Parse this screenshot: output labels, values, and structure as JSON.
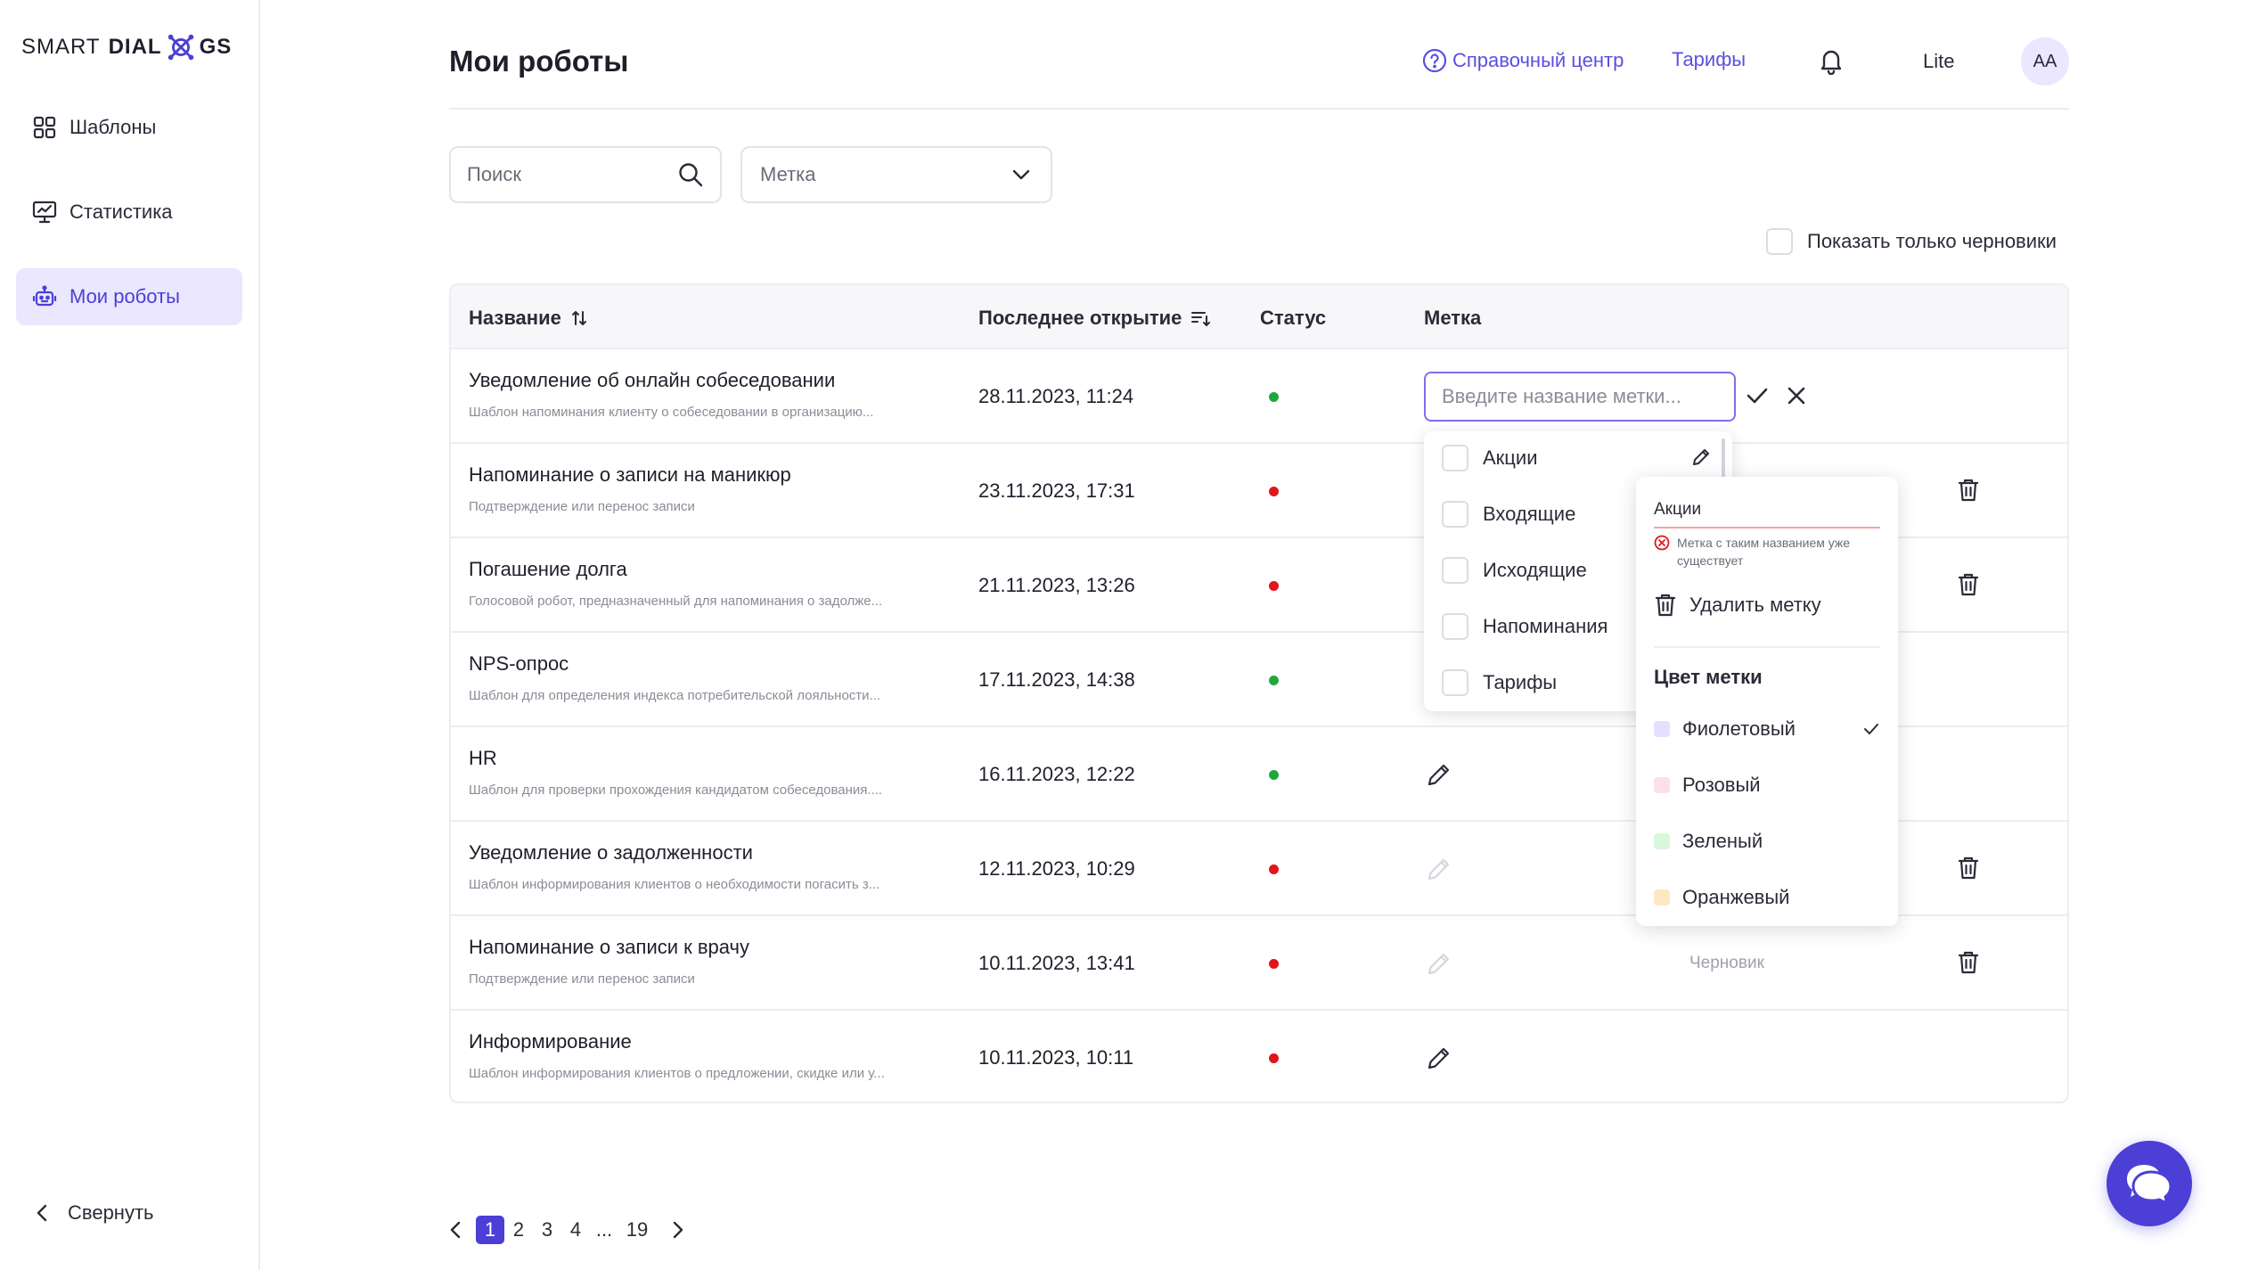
{
  "brand": {
    "logo_left": "SMART",
    "logo_right_a": "DIAL",
    "logo_right_b": "GS"
  },
  "sidebar": {
    "items": [
      {
        "label": "Шаблоны",
        "icon": "grid-icon"
      },
      {
        "label": "Статистика",
        "icon": "monitor-chart-icon"
      },
      {
        "label": "Мои роботы",
        "icon": "robot-icon",
        "active": true
      }
    ],
    "collapse_label": "Свернуть"
  },
  "header": {
    "title": "Мои роботы",
    "help_label": "Справочный центр",
    "tariffs_label": "Тарифы",
    "plan": "Lite",
    "avatar_initials": "AA"
  },
  "filters": {
    "search_placeholder": "Поиск",
    "tag_select_value": "Метка",
    "drafts_only_label": "Показать только черновики"
  },
  "table": {
    "columns": {
      "name": "Название",
      "last_opened": "Последнее открытие",
      "status": "Статус",
      "tag": "Метка"
    },
    "rows": [
      {
        "title": "Уведомление об онлайн собеседовании",
        "desc": "Шаблон напоминания клиенту о собеседовании в организацию...",
        "date": "28.11.2023, 11:24",
        "status": "active"
      },
      {
        "title": "Напоминание о записи на маникюр",
        "desc": "Подтверждение или перенос записи",
        "date": "23.11.2023, 17:31",
        "status": "inactive"
      },
      {
        "title": "Погашение долга",
        "desc": "Голосовой робот, предназначенный для напоминания о задолже...",
        "date": "21.11.2023, 13:26",
        "status": "inactive"
      },
      {
        "title": "NPS-опрос",
        "desc": "Шаблон для определения индекса потребительской лояльности...",
        "date": "17.11.2023, 14:38",
        "status": "active"
      },
      {
        "title": "HR",
        "desc": "Шаблон для проверки прохождения кандидатом собеседования....",
        "date": "16.11.2023, 12:22",
        "status": "active"
      },
      {
        "title": "Уведомление о задолженности",
        "desc": "Шаблон информирования клиентов о необходимости погасить з...",
        "date": "12.11.2023, 10:29",
        "status": "inactive"
      },
      {
        "title": "Напоминание о записи к врачу",
        "desc": "Подтверждение или перенос записи",
        "date": "10.11.2023, 13:41",
        "status": "inactive",
        "tag_note": "Черновик"
      },
      {
        "title": "Информирование",
        "desc": "Шаблон информирования клиентов о предложении, скидке или у...",
        "date": "10.11.2023, 10:11",
        "status": "inactive"
      }
    ]
  },
  "tag_editor": {
    "input_placeholder": "Введите название метки...",
    "options": [
      "Акции",
      "Входящие",
      "Исходящие",
      "Напоминания",
      "Тарифы"
    ]
  },
  "tag_popover": {
    "name": "Акции",
    "error": "Метка с таким названием уже существует",
    "delete_label": "Удалить метку",
    "color_heading": "Цвет метки",
    "colors": [
      {
        "label": "Фиолетовый",
        "hex": "#e4e0ff",
        "selected": true
      },
      {
        "label": "Розовый",
        "hex": "#fde0e6"
      },
      {
        "label": "Зеленый",
        "hex": "#d9f7dc"
      },
      {
        "label": "Оранжевый",
        "hex": "#ffe6c7"
      }
    ]
  },
  "pagination": {
    "pages": [
      "1",
      "2",
      "3",
      "4"
    ],
    "ellipsis": "...",
    "last": "19",
    "current": "1"
  },
  "colors": {
    "accent": "#4b3fd6",
    "status_active": "#1fa83a",
    "status_inactive": "#e0161b"
  }
}
